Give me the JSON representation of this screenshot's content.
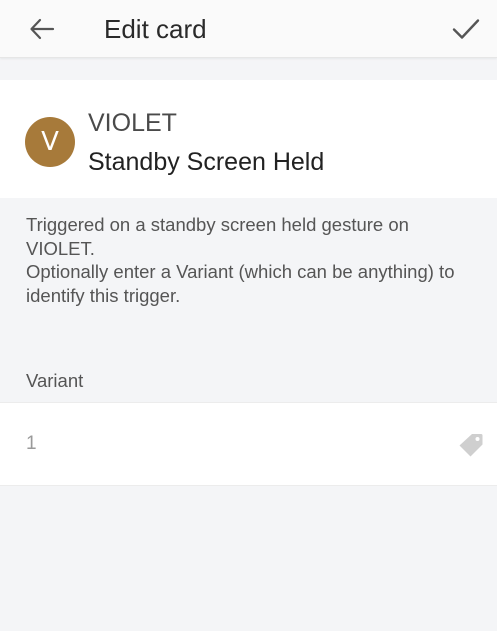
{
  "appbar": {
    "title": "Edit card",
    "back_icon": "arrow-left-icon",
    "confirm_icon": "check-icon"
  },
  "header": {
    "avatar_letter": "V",
    "avatar_color": "#a77a3a",
    "device_name": "VIOLET",
    "trigger_name": "Standby Screen Held"
  },
  "description": {
    "line1": "Triggered on a standby screen held gesture on VIOLET.",
    "line2": "Optionally enter a Variant (which can be anything) to identify this trigger."
  },
  "variant": {
    "label": "Variant",
    "value": "1",
    "icon": "tag-icon"
  }
}
